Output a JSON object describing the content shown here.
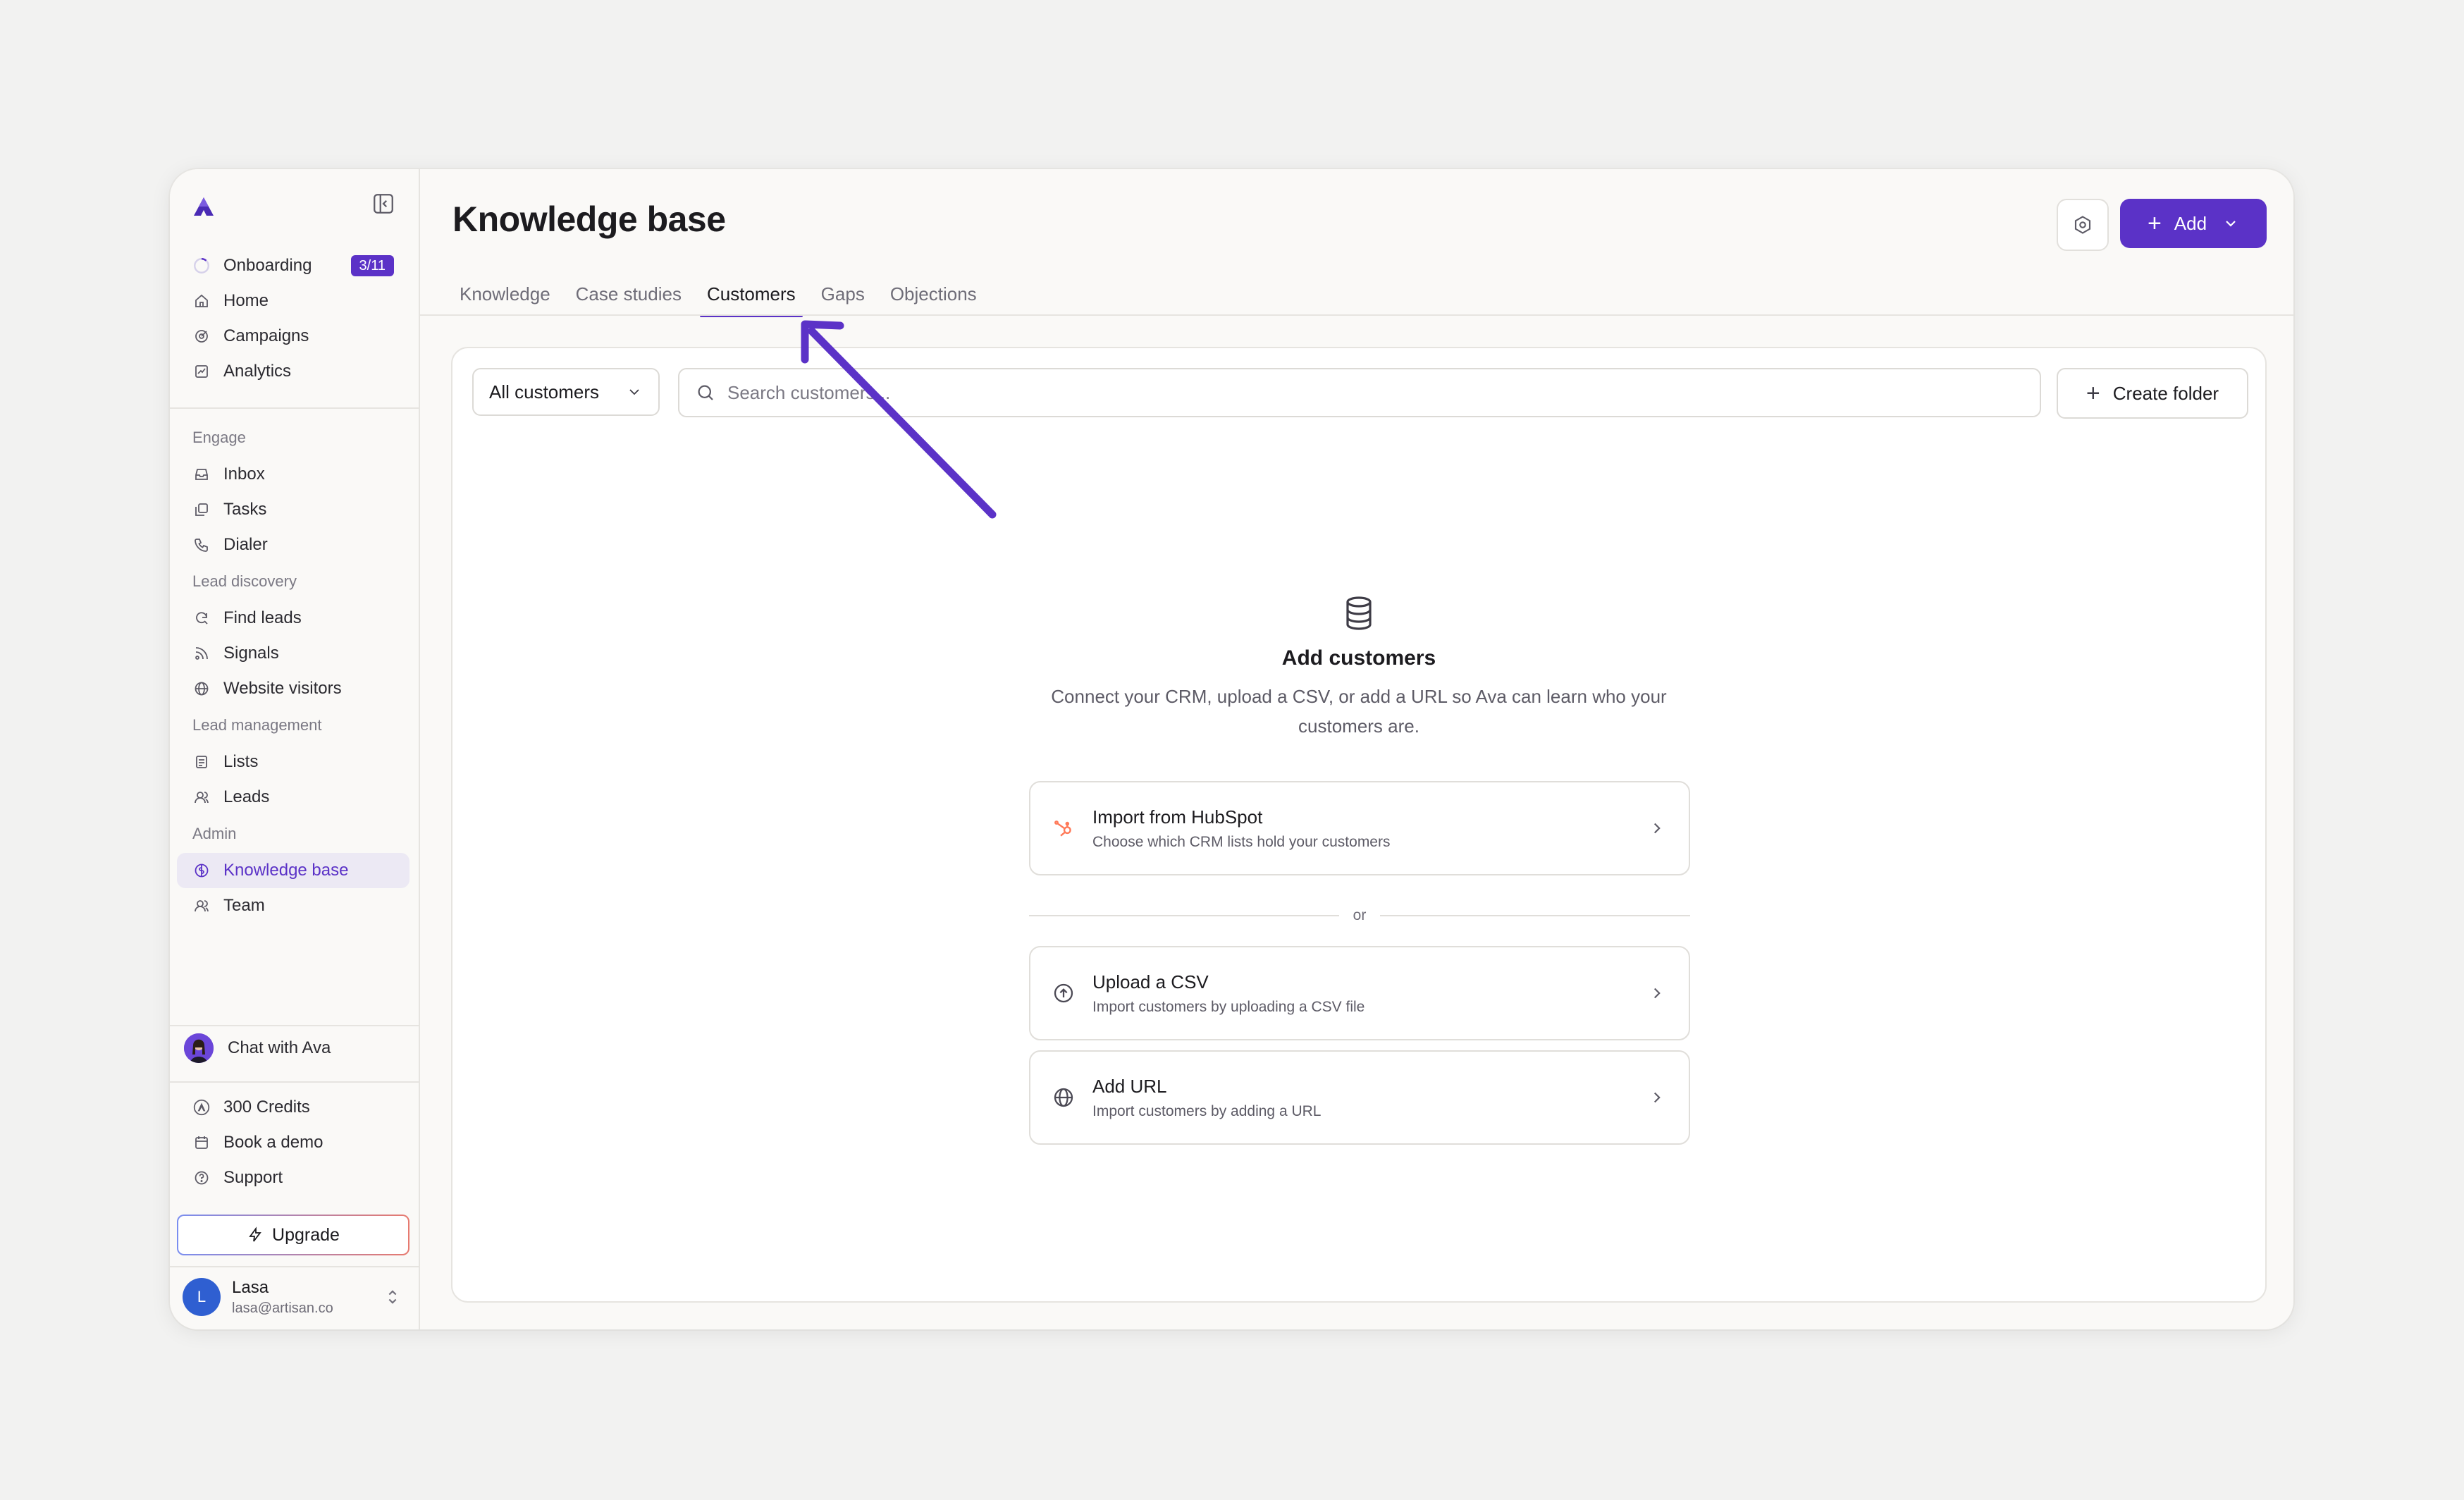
{
  "sidebar": {
    "items": [
      {
        "label": "Onboarding",
        "icon": "progress-circle-icon",
        "badge": "3/11"
      },
      {
        "label": "Home",
        "icon": "home-icon"
      },
      {
        "label": "Campaigns",
        "icon": "campaign-icon"
      },
      {
        "label": "Analytics",
        "icon": "analytics-icon"
      }
    ],
    "engage_header": "Engage",
    "engage": [
      {
        "label": "Inbox",
        "icon": "inbox-icon"
      },
      {
        "label": "Tasks",
        "icon": "tasks-icon"
      },
      {
        "label": "Dialer",
        "icon": "phone-icon"
      }
    ],
    "lead_discovery_header": "Lead discovery",
    "lead_discovery": [
      {
        "label": "Find leads",
        "icon": "find-leads-icon"
      },
      {
        "label": "Signals",
        "icon": "signals-icon"
      },
      {
        "label": "Website visitors",
        "icon": "globe-icon"
      }
    ],
    "lead_management_header": "Lead management",
    "lead_management": [
      {
        "label": "Lists",
        "icon": "list-icon"
      },
      {
        "label": "Leads",
        "icon": "users-icon"
      }
    ],
    "admin_header": "Admin",
    "admin": [
      {
        "label": "Knowledge base",
        "icon": "brain-icon",
        "active": true
      },
      {
        "label": "Team",
        "icon": "team-icon"
      }
    ],
    "chat_label": "Chat with Ava",
    "footer": [
      {
        "label": "300 Credits",
        "icon": "credits-icon"
      },
      {
        "label": "Book a demo",
        "icon": "calendar-icon"
      },
      {
        "label": "Support",
        "icon": "help-icon"
      }
    ],
    "upgrade_label": "Upgrade",
    "user": {
      "initial": "L",
      "name": "Lasa",
      "email": "lasa@artisan.co"
    }
  },
  "header": {
    "title": "Knowledge base",
    "add_label": "Add"
  },
  "tabs": [
    {
      "label": "Knowledge"
    },
    {
      "label": "Case studies"
    },
    {
      "label": "Customers",
      "active": true
    },
    {
      "label": "Gaps"
    },
    {
      "label": "Objections"
    }
  ],
  "toolbar": {
    "filter_value": "All customers",
    "search_placeholder": "Search customers...",
    "create_folder_label": "Create folder"
  },
  "empty_state": {
    "title": "Add customers",
    "description": "Connect your CRM, upload a CSV, or add a URL so Ava can learn who your customers are.",
    "or_label": "or",
    "options": [
      {
        "title": "Import from HubSpot",
        "subtitle": "Choose which CRM lists hold your customers",
        "icon": "hubspot-icon"
      },
      {
        "title": "Upload a CSV",
        "subtitle": "Import customers by uploading a CSV file",
        "icon": "upload-icon"
      },
      {
        "title": "Add URL",
        "subtitle": "Import customers by adding a URL",
        "icon": "globe-icon"
      }
    ]
  },
  "colors": {
    "accent": "#5b32c7",
    "annotation_arrow": "#5b32c7",
    "hubspot": "#ff7a59",
    "user_avatar": "#2f5fd1"
  }
}
